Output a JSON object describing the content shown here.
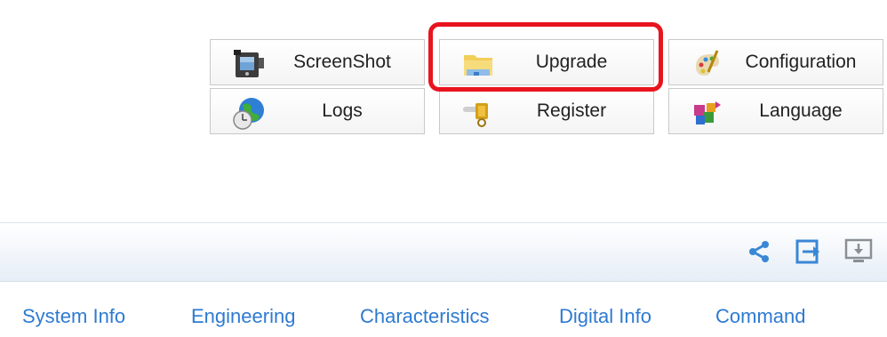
{
  "tools": {
    "screenshot": {
      "label": "ScreenShot",
      "icon": "camera-icon"
    },
    "logs": {
      "label": "Logs",
      "icon": "globe-clock-icon"
    },
    "upgrade": {
      "label": "Upgrade",
      "icon": "folder-icon"
    },
    "register": {
      "label": "Register",
      "icon": "lock-key-icon"
    },
    "configuration": {
      "label": "Configuration",
      "icon": "paint-palette-icon"
    },
    "language": {
      "label": "Language",
      "icon": "blocks-language-icon"
    }
  },
  "highlight": {
    "target": "Upgrade",
    "color": "#e8141e"
  },
  "toolbar_icons": [
    "share-icon",
    "export-icon",
    "monitor-download-icon"
  ],
  "nav": {
    "items": [
      {
        "label": "System Info"
      },
      {
        "label": "Engineering"
      },
      {
        "label": "Characteristics"
      },
      {
        "label": "Digital Info"
      },
      {
        "label": "Command"
      }
    ]
  },
  "colors": {
    "nav_link": "#2e7ad1",
    "toolbar_icon": "#3a87d6"
  }
}
